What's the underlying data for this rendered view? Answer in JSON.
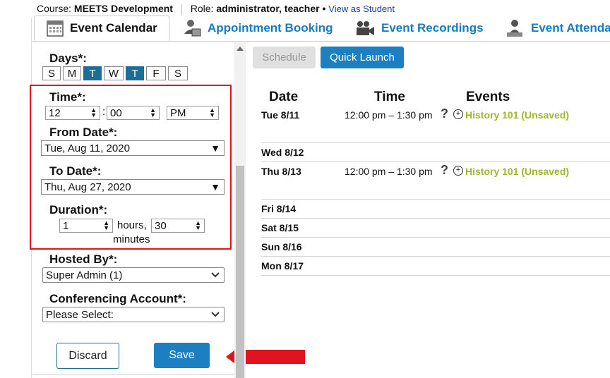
{
  "header": {
    "course_label": "Course:",
    "course_name": "MEETS Development",
    "role_label": "Role:",
    "role_value": "administrator, teacher",
    "bullet": "•",
    "view_as_student": "View as Student"
  },
  "tabs": [
    {
      "label": "Event Calendar",
      "icon": "calendar-icon",
      "active": true
    },
    {
      "label": "Appointment Booking",
      "icon": "person-desk-icon"
    },
    {
      "label": "Event Recordings",
      "icon": "video-camera-icon"
    },
    {
      "label": "Event Attendar",
      "icon": "attendees-icon"
    }
  ],
  "form": {
    "days_label": "Days*:",
    "days": [
      "S",
      "M",
      "T",
      "W",
      "T",
      "F",
      "S"
    ],
    "days_selected": [
      false,
      false,
      true,
      false,
      true,
      false,
      false
    ],
    "time_label": "Time*:",
    "time_hour": "12",
    "time_colon": ":",
    "time_minute": "00",
    "time_ampm": "PM",
    "from_label": "From Date*:",
    "from_value": "Tue, Aug 11, 2020",
    "to_label": "To Date*:",
    "to_value": "Thu, Aug 27, 2020",
    "duration_label": "Duration*:",
    "duration_hours": "1",
    "hours_text": "hours,",
    "duration_minutes": "30",
    "minutes_text": "minutes",
    "hosted_label": "Hosted By*:",
    "hosted_value": "Super Admin (1)",
    "conf_label": "Conferencing Account*:",
    "conf_value": "Please Select:",
    "discard_label": "Discard",
    "save_label": "Save"
  },
  "toolbar": {
    "schedule_label": "Schedule",
    "quick_launch_label": "Quick Launch"
  },
  "schedule": {
    "col_date": "Date",
    "col_time": "Time",
    "col_events": "Events",
    "rows": [
      {
        "date": "Tue 8/11",
        "time": "12:00 pm – 1:30 pm",
        "q": "?",
        "event": "History 101 (Unsaved)"
      },
      {
        "date": "Wed 8/12"
      },
      {
        "date": "Thu 8/13",
        "time": "12:00 pm – 1:30 pm",
        "q": "?",
        "event": "History 101 (Unsaved)"
      },
      {
        "date": "Fri 8/14"
      },
      {
        "date": "Sat 8/15"
      },
      {
        "date": "Sun 8/16"
      },
      {
        "date": "Mon 8/17"
      }
    ]
  },
  "colors": {
    "accent_blue": "#1a7bc0",
    "primary_button": "#1c7fc1",
    "highlight_red": "#e0141e",
    "event_green": "#a3b52a"
  }
}
